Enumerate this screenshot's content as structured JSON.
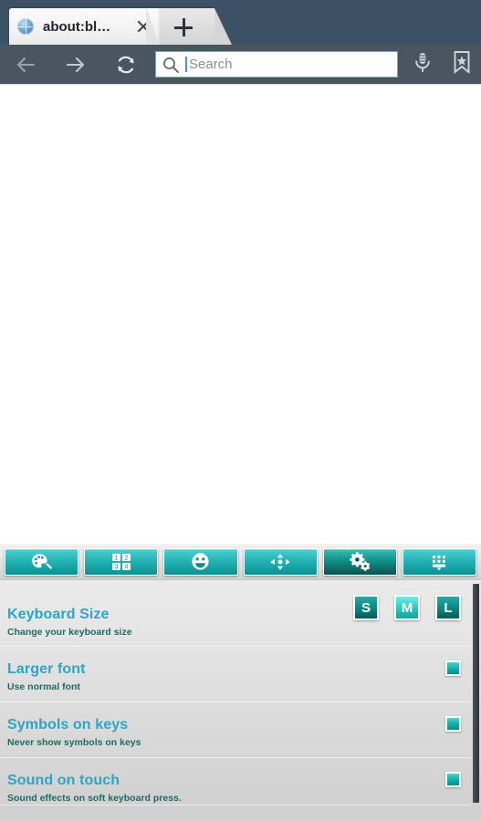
{
  "browser": {
    "tab": {
      "title": "about:bl…",
      "favicon": "globe-icon",
      "close": "×"
    },
    "new_tab_label": "+",
    "nav": {
      "back": "back-arrow-icon",
      "forward": "forward-arrow-icon",
      "reload": "reload-icon"
    },
    "address_bar": {
      "value": "",
      "placeholder": "Search",
      "search_icon": "search-icon"
    },
    "actions": {
      "voice": "microphone-icon",
      "bookmark": "bookmark-star-icon"
    },
    "colors": {
      "chrome": "#3d5166",
      "toolbar": "#4a5560",
      "addr_border": "#7ea6cc",
      "caret": "#4a90e2"
    }
  },
  "keyboard_panel": {
    "toolbar_keys": [
      {
        "name": "theme-palette-icon",
        "selected": false
      },
      {
        "name": "numeric-keypad-icon",
        "selected": false
      },
      {
        "name": "emoji-smiley-icon",
        "selected": false
      },
      {
        "name": "arrow-keys-icon",
        "selected": false
      },
      {
        "name": "settings-gears-icon",
        "selected": true
      },
      {
        "name": "keyboard-icon",
        "selected": false
      }
    ],
    "colors": {
      "accent_title": "#2ba6c4",
      "accent_sub": "#1d6a66",
      "key_teal": "#24b4b4",
      "key_selected_teal": "#139690",
      "panel_bg": "#e0e0e0"
    },
    "settings": [
      {
        "title": "Keyboard Size",
        "subtitle": "Change your keyboard size",
        "control": "size-group",
        "options": [
          {
            "label": "S",
            "selected": false
          },
          {
            "label": "M",
            "selected": true
          },
          {
            "label": "L",
            "selected": false
          }
        ]
      },
      {
        "title": "Larger font",
        "subtitle": "Use normal font",
        "control": "toggle",
        "checked": true
      },
      {
        "title": "Symbols on keys",
        "subtitle": "Never show symbols on keys",
        "control": "toggle",
        "checked": true
      },
      {
        "title": "Sound on touch",
        "subtitle": "Sound effects on soft keyboard press.",
        "control": "toggle",
        "checked": true
      }
    ]
  }
}
